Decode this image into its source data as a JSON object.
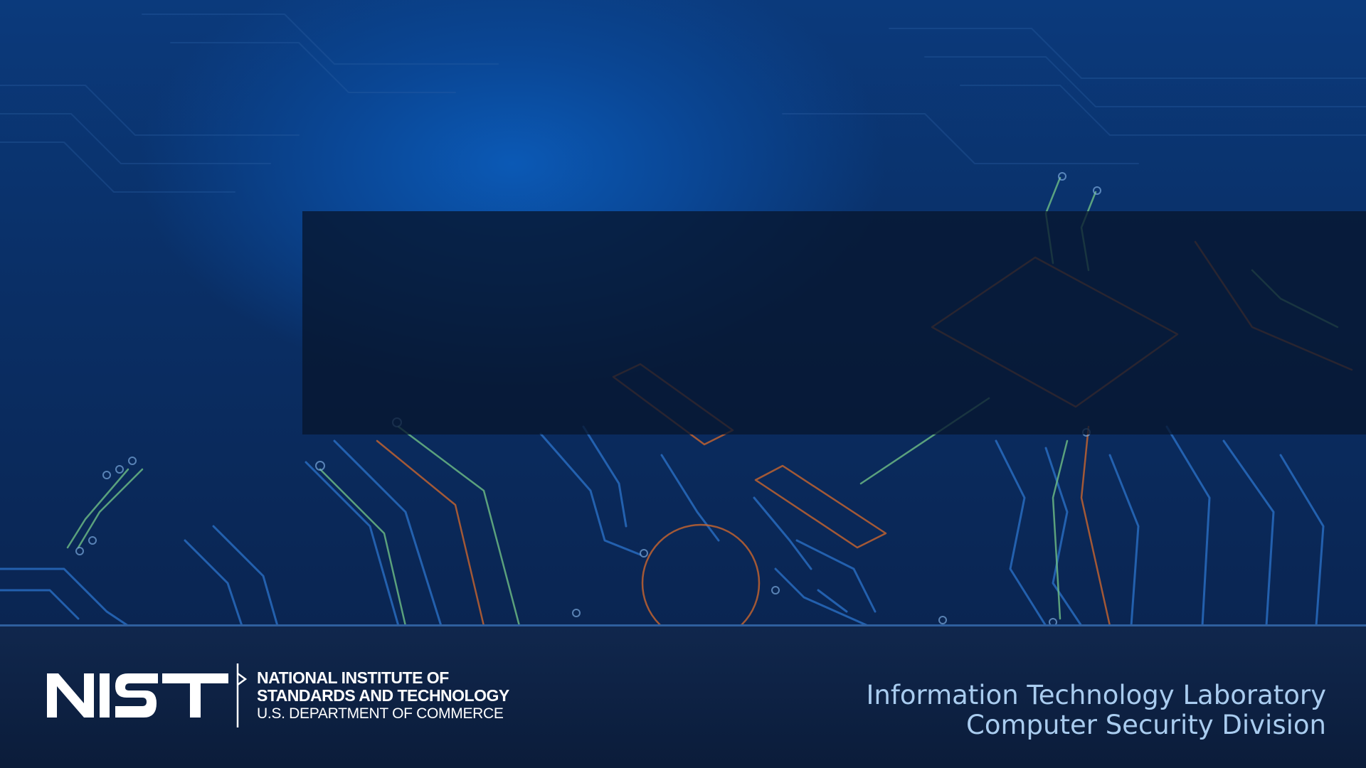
{
  "logo": {
    "wordmark": "NIST",
    "line1": "NATIONAL INSTITUTE OF",
    "line2": "STANDARDS AND TECHNOLOGY",
    "line3": "U.S. DEPARTMENT OF COMMERCE"
  },
  "footer": {
    "lab": "Information Technology Laboratory",
    "division": "Computer Security Division"
  },
  "colors": {
    "background": "#0a2f66",
    "footer": "#0b1c3a",
    "footer_text": "#a9ccef",
    "band": "#07162e"
  }
}
